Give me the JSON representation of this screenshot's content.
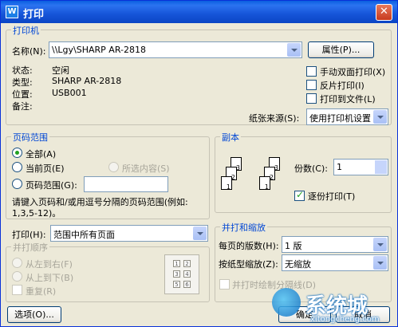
{
  "window": {
    "title": "打印",
    "app_icon": "W",
    "close_glyph": "✕"
  },
  "printer": {
    "group_label": "打印机",
    "name_label": "名称(N):",
    "name_value": "\\\\Lgy\\SHARP AR-2818",
    "properties_button": "属性(P)...",
    "status_label": "状态:",
    "status_value": "空闲",
    "type_label": "类型:",
    "type_value": "SHARP AR-2818",
    "location_label": "位置:",
    "location_value": "USB001",
    "comment_label": "备注:",
    "comment_value": "",
    "manual_duplex": "手动双面打印(X)",
    "reverse_print": "反片打印(I)",
    "print_to_file": "打印到文件(L)",
    "paper_source_label": "纸张来源(S):",
    "paper_source_value": "使用打印机设置"
  },
  "page_range": {
    "group_label": "页码范围",
    "all": "全部(A)",
    "current_page": "当前页(E)",
    "selection": "所选内容(S)",
    "pages": "页码范围(G):",
    "pages_value": "",
    "hint": "请键入页码和/或用逗号分隔的页码范围(例如:",
    "hint2": "1,3,5-12)。"
  },
  "print_what": {
    "label": "打印(H):",
    "value": "范围中所有页面"
  },
  "collate_order": {
    "group_label": "并打顺序",
    "left_to_right": "从左到右(F)",
    "top_to_bottom": "从上到下(B)",
    "repeat": "重复(R)",
    "layout_cells": [
      "1",
      "2",
      "3",
      "4",
      "5",
      "6"
    ]
  },
  "copies": {
    "group_label": "副本",
    "count_label": "份数(C):",
    "count_value": "1",
    "collate": "逐份打印(T)",
    "page_numbers": [
      "3",
      "2",
      "1",
      "3",
      "2",
      "1"
    ]
  },
  "zoom": {
    "group_label": "并打和缩放",
    "pages_per_sheet_label": "每页的版数(H):",
    "pages_per_sheet_value": "1 版",
    "scale_label": "按纸型缩放(Z):",
    "scale_value": "无缩放",
    "draw_borders": "并打时绘制分隔线(D)"
  },
  "footer": {
    "options_button": "选项(O)...",
    "ok_button": "确定",
    "cancel_button": "取消"
  },
  "watermark": {
    "brand": "系统城",
    "url": "xitongcheng.com"
  }
}
